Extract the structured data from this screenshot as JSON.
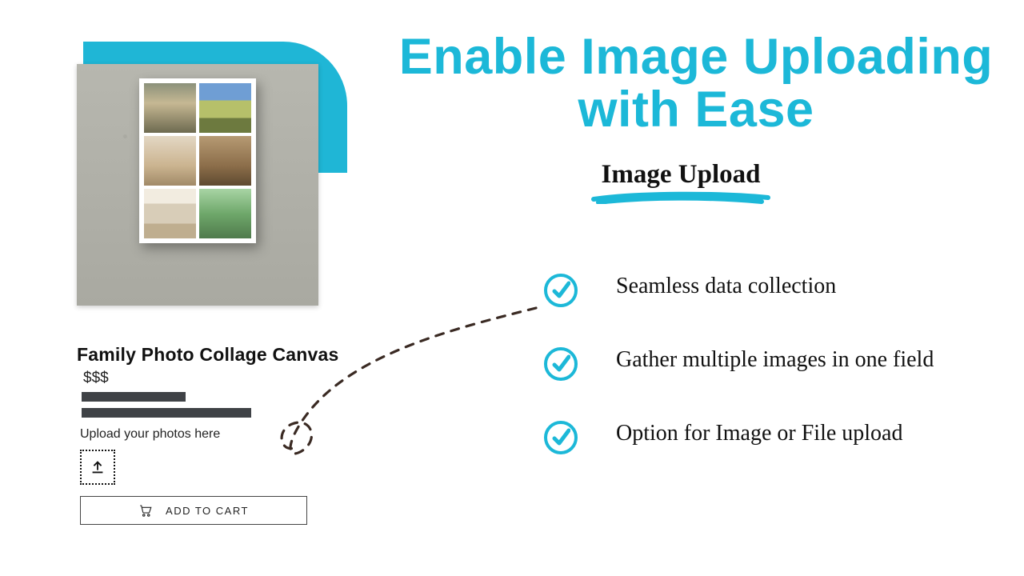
{
  "colors": {
    "accent": "#1cb8d8",
    "ink": "#111111",
    "bar": "#3f4246"
  },
  "product": {
    "title": "Family Photo Collage Canvas",
    "price": "$$$",
    "upload_label": "Upload your photos here",
    "add_to_cart_label": "ADD TO CART"
  },
  "headline": "Enable Image Uploading with Ease",
  "subhead": "Image Upload",
  "features": [
    "Seamless data collection",
    "Gather multiple images in one field",
    "Option for Image or File upload"
  ],
  "icons": {
    "upload": "upload-icon",
    "cart": "cart-icon",
    "check": "check-icon"
  }
}
